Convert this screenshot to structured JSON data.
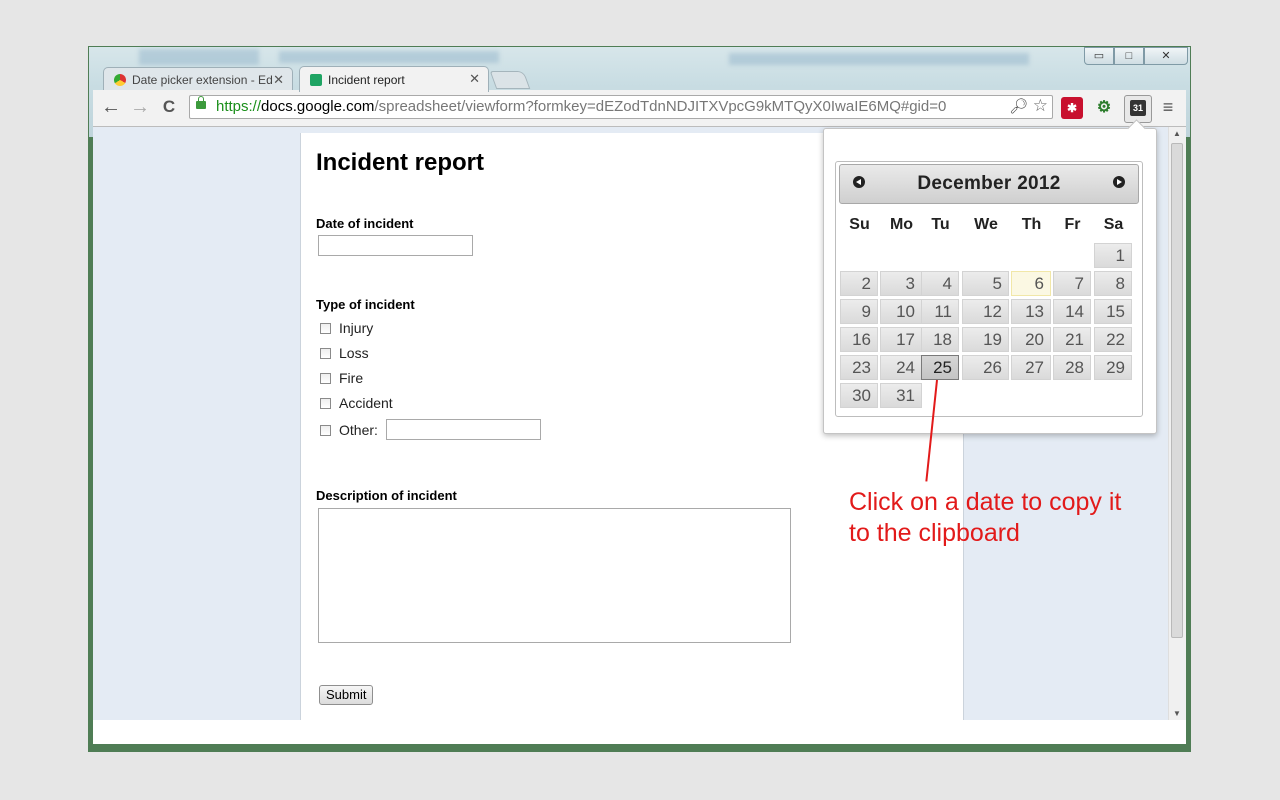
{
  "window": {
    "controls": [
      "▭",
      "□",
      "✕"
    ]
  },
  "tabs": [
    {
      "title": "Date picker extension - Ed",
      "close": "✕"
    },
    {
      "title": "Incident report",
      "close": "✕"
    }
  ],
  "toolbar": {
    "back": "←",
    "forward": "→",
    "reload": "C",
    "url_scheme": "https://",
    "url_host": "docs.google.com",
    "url_path": "/spreadsheet/viewform?formkey=dEZodTdnNDJITXVpcG9kMTQyX0IwaIE6MQ#gid=0",
    "zoom_icon": "search-icon",
    "star_icon": "star-icon",
    "menu_icon": "menu-icon",
    "extensions": [
      "lastpass-icon",
      "tools-icon",
      "calendar-31-icon"
    ],
    "calendar_ext_label": "31"
  },
  "form": {
    "title": "Incident report",
    "date_label": "Date of incident",
    "date_value": "",
    "type_label": "Type of incident",
    "options": [
      "Injury",
      "Loss",
      "Fire",
      "Accident",
      "Other:"
    ],
    "other_value": "",
    "desc_label": "Description of incident",
    "desc_value": "",
    "submit_label": "Submit"
  },
  "calendar": {
    "month": "December 2012",
    "weekdays": [
      "Su",
      "Mo",
      "Tu",
      "We",
      "Th",
      "Fr",
      "Sa"
    ],
    "days": [
      "1",
      "2",
      "3",
      "4",
      "5",
      "6",
      "7",
      "8",
      "9",
      "10",
      "11",
      "12",
      "13",
      "14",
      "15",
      "16",
      "17",
      "18",
      "19",
      "20",
      "21",
      "22",
      "23",
      "24",
      "25",
      "26",
      "27",
      "28",
      "29",
      "30",
      "31"
    ],
    "today": "6",
    "selected": "25"
  },
  "annotation": {
    "line1": "Click on a date to copy it",
    "line2": "to the clipboard",
    "color": "#e21a1a"
  }
}
